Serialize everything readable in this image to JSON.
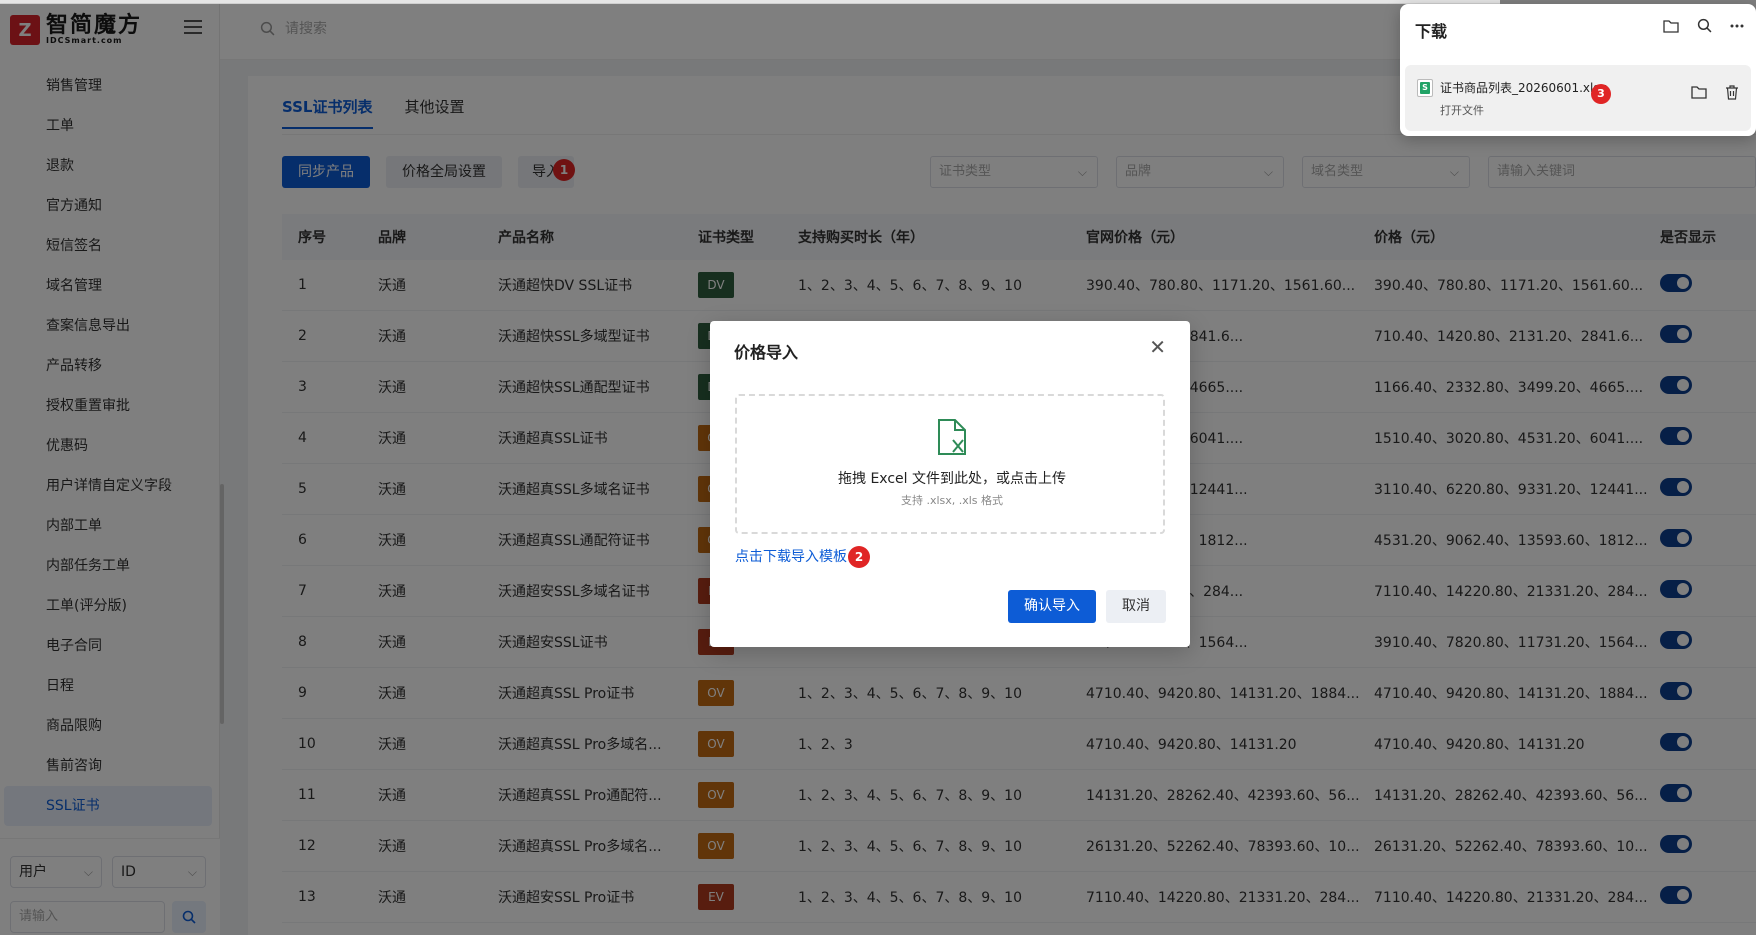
{
  "logo": {
    "mark": "Z",
    "text": "智简魔方",
    "sub": "IDCSmart.com"
  },
  "topbar": {
    "search_placeholder": "请搜索"
  },
  "sidebar": {
    "items": [
      "销售管理",
      "工单",
      "退款",
      "官方通知",
      "短信签名",
      "域名管理",
      "查案信息导出",
      "产品转移",
      "授权重置审批",
      "优惠码",
      "用户详情自定义字段",
      "内部工单",
      "内部任务工单",
      "工单(评分版)",
      "电子合同",
      "日程",
      "商品限购",
      "售前咨询",
      "SSL证书"
    ],
    "active": "SSL证书",
    "bottom": {
      "select1": "用户",
      "select2": "ID",
      "input_placeholder": "请输入"
    }
  },
  "tabs": [
    {
      "label": "SSL证书列表",
      "active": true
    },
    {
      "label": "其他设置",
      "active": false
    }
  ],
  "toolbar": {
    "sync_label": "同步产品",
    "price_global_label": "价格全局设置",
    "import_label": "导入",
    "filters": {
      "cert_type": "证书类型",
      "brand": "品牌",
      "domain_type": "域名类型",
      "keyword": "请输入关键词"
    }
  },
  "table": {
    "headers": [
      "序号",
      "品牌",
      "产品名称",
      "证书类型",
      "支持购买时长（年）",
      "官网价格（元）",
      "价格（元）",
      "是否显示"
    ],
    "rows": [
      {
        "no": "1",
        "brand": "沃通",
        "name": "沃通超快DV SSL证书",
        "type": "DV",
        "years": "1、2、3、4、5、6、7、8、9、10",
        "official": "390.40、780.80、1171.20、1561.60...",
        "price": "390.40、780.80、1171.20、1561.60...",
        "show": true
      },
      {
        "no": "2",
        "brand": "沃通",
        "name": "沃通超快SSL多域型证书",
        "type": "DV",
        "years": "",
        "official": "0、2131.20、2841.6...",
        "price": "710.40、1420.80、2131.20、2841.6...",
        "show": true
      },
      {
        "no": "3",
        "brand": "沃通",
        "name": "沃通超快SSL通配型证书",
        "type": "DV",
        "years": "",
        "official": "80、3499.20、4665....",
        "price": "1166.40、2332.80、3499.20、4665....",
        "show": true
      },
      {
        "no": "4",
        "brand": "沃通",
        "name": "沃通超真SSL证书",
        "type": "OV",
        "years": "",
        "official": "80、4531.20、6041....",
        "price": "1510.40、3020.80、4531.20、6041....",
        "show": true
      },
      {
        "no": "5",
        "brand": "沃通",
        "name": "沃通超真SSL多域名证书",
        "type": "OV",
        "years": "",
        "official": "80、9331.20、12441...",
        "price": "3110.40、6220.80、9331.20、12441...",
        "show": true
      },
      {
        "no": "6",
        "brand": "沃通",
        "name": "沃通超真SSL通配符证书",
        "type": "OV",
        "years": "",
        "official": "40、13593.60、1812...",
        "price": "4531.20、9062.40、13593.60、1812...",
        "show": true
      },
      {
        "no": "7",
        "brand": "沃通",
        "name": "沃通超安SSL多域名证书",
        "type": "EV",
        "years": "",
        "official": ".80、21331.20、284...",
        "price": "7110.40、14220.80、21331.20、284...",
        "show": true
      },
      {
        "no": "8",
        "brand": "沃通",
        "name": "沃通超安SSL证书",
        "type": "EV",
        "years": "",
        "official": "80、11731.20、1564...",
        "price": "3910.40、7820.80、11731.20、1564...",
        "show": true
      },
      {
        "no": "9",
        "brand": "沃通",
        "name": "沃通超真SSL Pro证书",
        "type": "OV",
        "years": "1、2、3、4、5、6、7、8、9、10",
        "official": "4710.40、9420.80、14131.20、1884...",
        "price": "4710.40、9420.80、14131.20、1884...",
        "show": true
      },
      {
        "no": "10",
        "brand": "沃通",
        "name": "沃通超真SSL Pro多域名...",
        "type": "OV",
        "years": "1、2、3",
        "official": "4710.40、9420.80、14131.20",
        "price": "4710.40、9420.80、14131.20",
        "show": true
      },
      {
        "no": "11",
        "brand": "沃通",
        "name": "沃通超真SSL Pro通配符...",
        "type": "OV",
        "years": "1、2、3、4、5、6、7、8、9、10",
        "official": "14131.20、28262.40、42393.60、56...",
        "price": "14131.20、28262.40、42393.60、56...",
        "show": true
      },
      {
        "no": "12",
        "brand": "沃通",
        "name": "沃通超真SSL Pro多域名...",
        "type": "OV",
        "years": "1、2、3、4、5、6、7、8、9、10",
        "official": "26131.20、52262.40、78393.60、10...",
        "price": "26131.20、52262.40、78393.60、10...",
        "show": true
      },
      {
        "no": "13",
        "brand": "沃通",
        "name": "沃通超安SSL Pro证书",
        "type": "EV",
        "years": "1、2、3、4、5、6、7、8、9、10",
        "official": "7110.40、14220.80、21331.20、284...",
        "price": "7110.40、14220.80、21331.20、284...",
        "show": true
      }
    ]
  },
  "cert_colors": {
    "DV": "#2f5e3e",
    "OV": "#c26a12",
    "EV": "#b03a1f"
  },
  "modal": {
    "title": "价格导入",
    "drop_text": "拖拽 Excel 文件到此处，或点击上传",
    "drop_sub": "支持 .xlsx, .xls 格式",
    "download_link": "点击下载导入模板",
    "confirm_label": "确认导入",
    "cancel_label": "取消"
  },
  "download_panel": {
    "title": "下载",
    "file_name": "证书商品列表_20260601.xlsx",
    "open_label": "打开文件",
    "file_badge": "S"
  },
  "annotations": {
    "n1": "1",
    "n2": "2",
    "n3": "3"
  }
}
